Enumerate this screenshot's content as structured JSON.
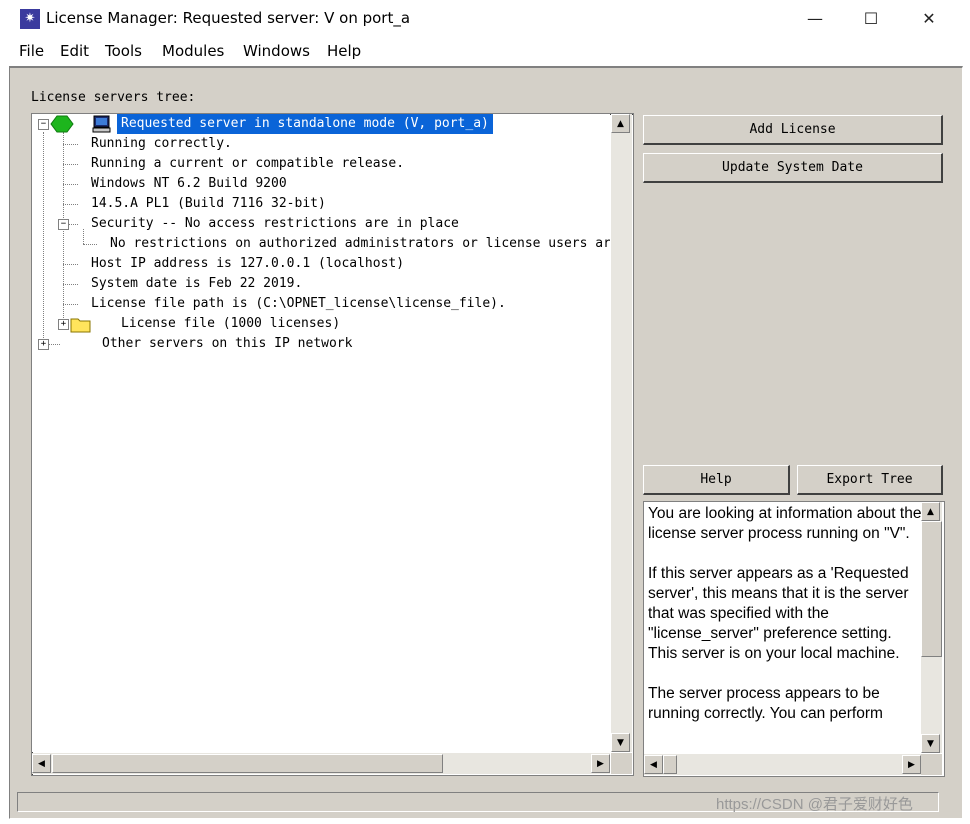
{
  "window": {
    "title": "License Manager: Requested server: V on port_a",
    "minimize_glyph": "—",
    "maximize_glyph": "☐",
    "close_glyph": "✕"
  },
  "menu": [
    "File",
    "Edit",
    "Tools",
    "Modules",
    "Windows",
    "Help"
  ],
  "tree": {
    "label": "License servers tree:",
    "rows": [
      "Requested server in standalone mode (V, port_a)",
      "Running correctly.",
      "Running a current or compatible release.",
      "Windows NT 6.2 Build 9200",
      "14.5.A PL1 (Build 7116 32-bit)",
      "Security -- No access restrictions are in place",
      "No restrictions on authorized administrators or license users are i",
      "Host IP address is 127.0.0.1 (localhost)",
      "System date is Feb 22 2019.",
      "License file path is (C:\\OPNET_license\\license_file).",
      "License file (1000 licenses)",
      "Other servers on this IP network"
    ]
  },
  "buttons": {
    "add_license": "Add License",
    "update_system_date": "Update System Date",
    "help": "Help",
    "export_tree": "Export Tree"
  },
  "info_text": "You are looking at information about the license server process running on \"V\".\n\nIf this server appears as a 'Requested server', this means that it is the server that was specified with the \"license_server\" preference setting.\nThis server is on your local machine.\n\nThe server process appears to be running correctly. You can perform",
  "watermark": "https://CSDN @君子爱财好色",
  "colors": {
    "selection": "#0a64d8",
    "status_green": "#1db51d",
    "face": "#d4d0c8"
  },
  "icons": [
    "app-icon",
    "server-status-icon",
    "computer-icon",
    "folder-icon"
  ]
}
